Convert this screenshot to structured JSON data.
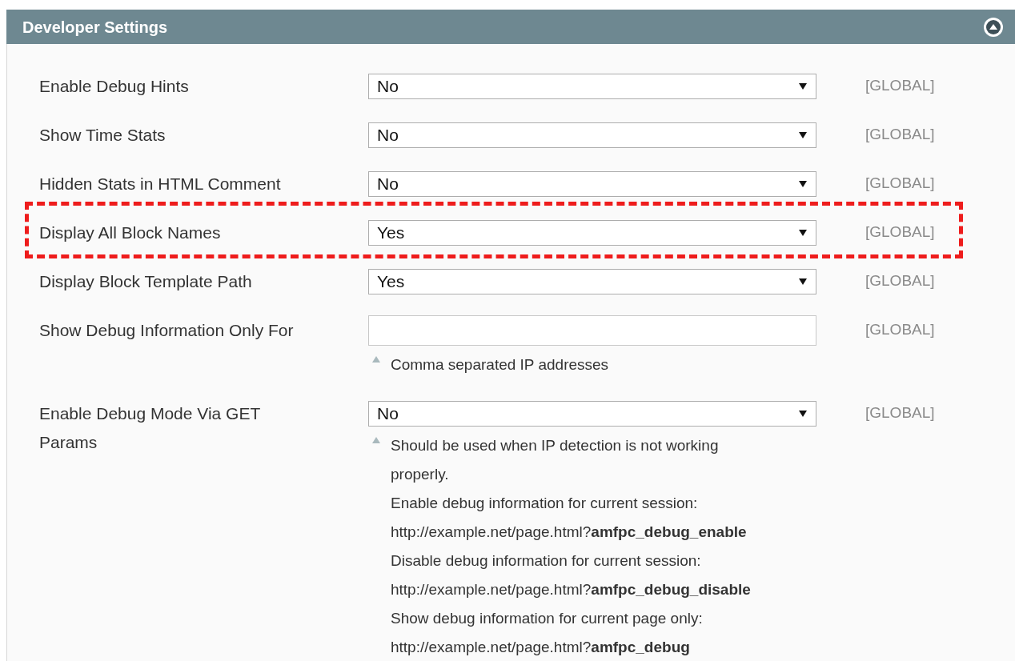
{
  "section": {
    "title": "Developer Settings",
    "expanded": true
  },
  "rows": [
    {
      "label": "Enable Debug Hints",
      "kind": "select",
      "value": "No",
      "scope": "[GLOBAL]",
      "highlighted": false
    },
    {
      "label": "Show Time Stats",
      "kind": "select",
      "value": "No",
      "scope": "[GLOBAL]",
      "highlighted": false
    },
    {
      "label": "Hidden Stats in HTML Comment",
      "kind": "select",
      "value": "No",
      "scope": "[GLOBAL]",
      "highlighted": false
    },
    {
      "label": "Display All Block Names",
      "kind": "select",
      "value": "Yes",
      "scope": "[GLOBAL]",
      "highlighted": true
    },
    {
      "label": "Display Block Template Path",
      "kind": "select",
      "value": "Yes",
      "scope": "[GLOBAL]",
      "highlighted": false
    },
    {
      "label": "Show Debug Information Only For",
      "kind": "text",
      "scope": "[GLOBAL]",
      "highlighted": false,
      "notes": [
        "Comma separated IP addresses"
      ]
    },
    {
      "label": "Enable Debug Mode Via GET Params",
      "kind": "select",
      "value": "No",
      "scope": "[GLOBAL]",
      "highlighted": false,
      "notes": [
        "Should be used when IP detection is not working properly.",
        "Enable debug information for current session:",
        "http://example.net/page.html?**amfpc_debug_enable**",
        "Disable debug information for current session:",
        "http://example.net/page.html?**amfpc_debug_disable**",
        "Show debug information for current page only:",
        "http://example.net/page.html?**amfpc_debug**"
      ]
    }
  ]
}
